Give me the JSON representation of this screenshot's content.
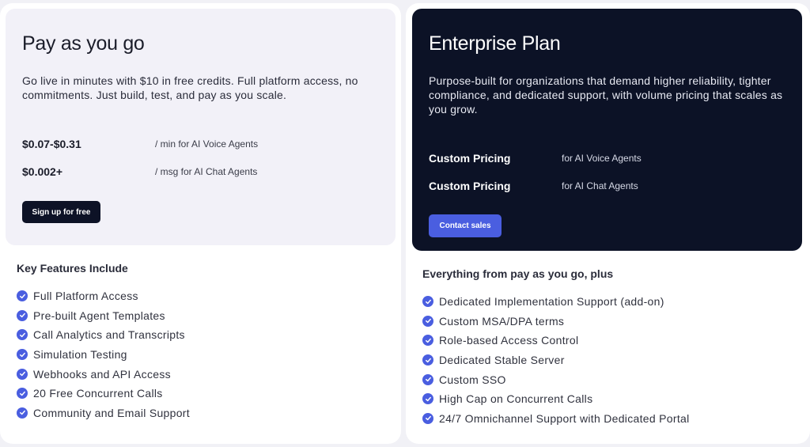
{
  "payg": {
    "title": "Pay as you go",
    "description": "Go live in minutes with $10 in free credits. Full platform access, no commitments. Just build, test, and pay as you scale.",
    "prices": [
      {
        "value": "$0.07-$0.31",
        "note": "/ min for AI Voice Agents"
      },
      {
        "value": "$0.002+",
        "note": "/ msg for AI Chat Agents"
      }
    ],
    "cta_label": "Sign up for free",
    "features_heading": "Key Features Include",
    "features": [
      "Full Platform Access",
      "Pre-built Agent Templates",
      "Call Analytics and Transcripts",
      "Simulation Testing",
      "Webhooks and API Access",
      "20 Free Concurrent Calls",
      "Community and Email Support"
    ]
  },
  "enterprise": {
    "title": "Enterprise Plan",
    "description": "Purpose-built for organizations that demand higher reliability, tighter compliance, and dedicated support, with volume pricing that scales as you grow.",
    "prices": [
      {
        "value": "Custom Pricing",
        "note": "for AI Voice Agents"
      },
      {
        "value": "Custom Pricing",
        "note": "for AI Chat Agents"
      }
    ],
    "cta_label": "Contact sales",
    "features_heading": "Everything from pay as you go, plus",
    "features": [
      "Dedicated Implementation Support (add-on)",
      "Custom MSA/DPA terms",
      "Role-based Access Control",
      "Dedicated Stable Server",
      "Custom SSO",
      "High Cap on Concurrent Calls",
      "24/7 Omnichannel Support with Dedicated Portal"
    ]
  },
  "icons": {
    "check": "check-circle-icon"
  },
  "colors": {
    "accent": "#4a5ee0",
    "dark_panel": "#0c1226",
    "light_panel": "#f2f1f8",
    "page_bg": "#f1f1f6"
  }
}
